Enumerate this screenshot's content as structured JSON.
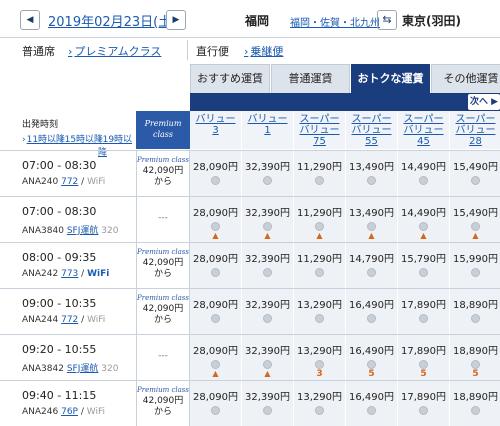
{
  "header": {
    "prev_icon": "◀",
    "date": "2019年02月23日(土)",
    "next_icon": "▶",
    "from": "福岡",
    "from_sub": "福岡・佐賀・北九州",
    "swap_icon": "⇆",
    "to": "東京(羽田)"
  },
  "options": {
    "seat_label": "普通席",
    "premium_link": "プレミアムクラス",
    "direct_label": "直行便",
    "connect_link": "乗継便"
  },
  "tabs": [
    "おすすめ運賃",
    "普通運賃",
    "おトクな運賃",
    "その他運賃"
  ],
  "next_label": "次へ ▶",
  "list_header": {
    "title": "出発時刻",
    "sort_links": [
      "11時以降",
      "15時以降",
      "19時以降"
    ],
    "premium_line1": "Premium",
    "premium_line2": "class"
  },
  "fare_columns": [
    [
      "バリュー",
      "3"
    ],
    [
      "バリュー",
      "1"
    ],
    [
      "スーパー",
      "バリュー",
      "75"
    ],
    [
      "スーパー",
      "バリュー",
      "55"
    ],
    [
      "スーパー",
      "バリュー",
      "45"
    ],
    [
      "スーパー",
      "バリュー",
      "28"
    ]
  ],
  "flights": [
    {
      "time": "07:00 - 08:30",
      "flight_no": "ANA240",
      "aircraft": "772",
      "sfj": "",
      "wifi": "WiFi",
      "wifi_on": false,
      "premium": {
        "has": true,
        "logo": "Premium class",
        "price": "42,090円",
        "suffix": "から"
      },
      "fares": [
        {
          "price": "28,090円",
          "mark": ""
        },
        {
          "price": "32,390円",
          "mark": ""
        },
        {
          "price": "11,290円",
          "mark": ""
        },
        {
          "price": "13,490円",
          "mark": ""
        },
        {
          "price": "14,490円",
          "mark": ""
        },
        {
          "price": "15,490円",
          "mark": ""
        }
      ]
    },
    {
      "time": "07:00 - 08:30",
      "flight_no": "ANA3840",
      "aircraft": "",
      "sfj": "SFJ運航",
      "wifi": "320",
      "wifi_on": false,
      "premium": {
        "has": false,
        "dash": "---"
      },
      "fares": [
        {
          "price": "28,090円",
          "mark": "▲"
        },
        {
          "price": "32,390円",
          "mark": "▲"
        },
        {
          "price": "11,290円",
          "mark": "▲"
        },
        {
          "price": "13,490円",
          "mark": "▲"
        },
        {
          "price": "14,490円",
          "mark": "▲"
        },
        {
          "price": "15,490円",
          "mark": "▲"
        }
      ]
    },
    {
      "time": "08:00 - 09:35",
      "flight_no": "ANA242",
      "aircraft": "773",
      "sfj": "",
      "wifi": "WiFi",
      "wifi_on": true,
      "premium": {
        "has": true,
        "logo": "Premium class",
        "price": "42,090円",
        "suffix": "から"
      },
      "fares": [
        {
          "price": "28,090円",
          "mark": ""
        },
        {
          "price": "32,390円",
          "mark": ""
        },
        {
          "price": "11,290円",
          "mark": ""
        },
        {
          "price": "14,790円",
          "mark": ""
        },
        {
          "price": "15,790円",
          "mark": ""
        },
        {
          "price": "15,990円",
          "mark": ""
        }
      ]
    },
    {
      "time": "09:00 - 10:35",
      "flight_no": "ANA244",
      "aircraft": "772",
      "sfj": "",
      "wifi": "WiFi",
      "wifi_on": false,
      "premium": {
        "has": true,
        "logo": "Premium class",
        "price": "42,090円",
        "suffix": "から"
      },
      "fares": [
        {
          "price": "28,090円",
          "mark": ""
        },
        {
          "price": "32,390円",
          "mark": ""
        },
        {
          "price": "13,290円",
          "mark": ""
        },
        {
          "price": "16,490円",
          "mark": ""
        },
        {
          "price": "17,890円",
          "mark": ""
        },
        {
          "price": "18,890円",
          "mark": ""
        }
      ]
    },
    {
      "time": "09:20 - 10:55",
      "flight_no": "ANA3842",
      "aircraft": "",
      "sfj": "SFJ運航",
      "wifi": "320",
      "wifi_on": false,
      "premium": {
        "has": false,
        "dash": "---"
      },
      "fares": [
        {
          "price": "28,090円",
          "mark": "▲"
        },
        {
          "price": "32,390円",
          "mark": "▲"
        },
        {
          "price": "13,290円",
          "mark": "3"
        },
        {
          "price": "16,490円",
          "mark": "5"
        },
        {
          "price": "17,890円",
          "mark": "5"
        },
        {
          "price": "18,890円",
          "mark": "5"
        }
      ]
    },
    {
      "time": "09:40 - 11:15",
      "flight_no": "ANA246",
      "aircraft": "76P",
      "sfj": "",
      "wifi": "WiFi",
      "wifi_on": false,
      "premium": {
        "has": true,
        "logo": "Premium class",
        "price": "42,090円",
        "suffix": "から"
      },
      "fares": [
        {
          "price": "28,090円",
          "mark": ""
        },
        {
          "price": "32,390円",
          "mark": ""
        },
        {
          "price": "13,290円",
          "mark": ""
        },
        {
          "price": "16,490円",
          "mark": ""
        },
        {
          "price": "17,890円",
          "mark": ""
        },
        {
          "price": "18,890円",
          "mark": ""
        }
      ]
    }
  ]
}
